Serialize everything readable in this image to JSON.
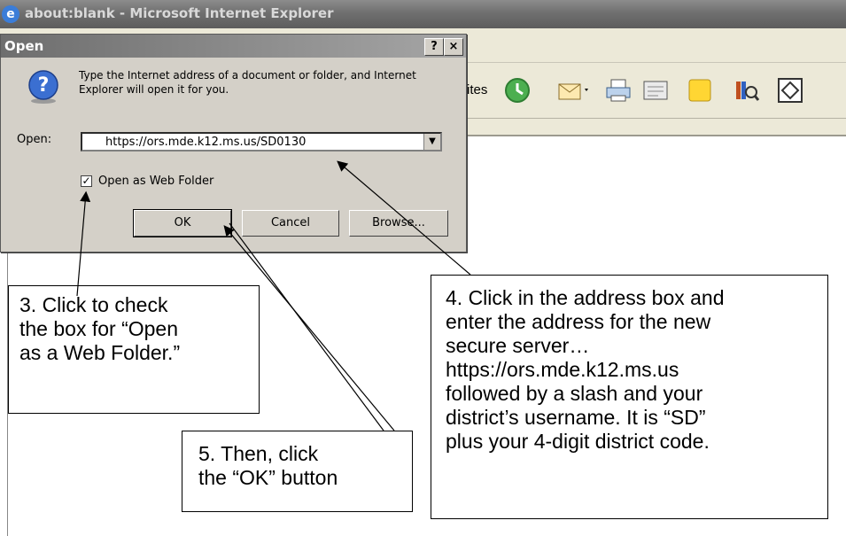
{
  "browser": {
    "title": "about:blank - Microsoft Internet Explorer",
    "toolbar_partial_label": "rites"
  },
  "dialog": {
    "title": "Open",
    "help_button": "?",
    "close_button": "×",
    "instruction": "Type the Internet address of a document or folder, and Internet Explorer will open it for you.",
    "open_label": "Open:",
    "address_value": "https://ors.mde.k12.ms.us/SD0130",
    "checkbox_label": "Open as Web Folder",
    "checkbox_checked": true,
    "ok_label": "OK",
    "cancel_label": "Cancel",
    "browse_label": "Browse..."
  },
  "callouts": {
    "step3": "3. Click to check\nthe box for “Open\nas a Web Folder.”",
    "step4": "4. Click in the address box and\nenter the address for the new\nsecure server…\nhttps://ors.mde.k12.ms.us\nfollowed by a slash and your\ndistrict’s username. It is “SD”\nplus your 4-digit district code.",
    "step5": "5. Then, click\nthe “OK” button"
  }
}
